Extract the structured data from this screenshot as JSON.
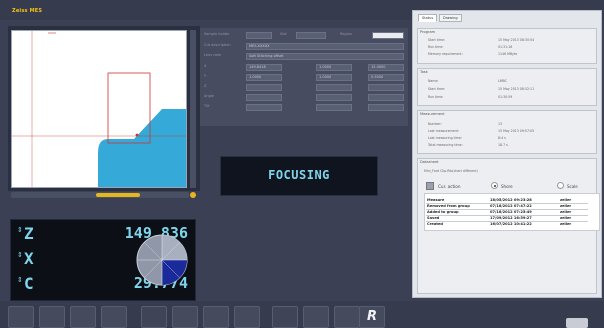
{
  "app": {
    "title": "Zeiss MES"
  },
  "form": {
    "rows": [
      {
        "label": "Sample holder",
        "value": "",
        "label2": "Slot",
        "value2": "",
        "label3": "Region",
        "value3": ""
      },
      {
        "label": "Cut description",
        "value": "MES-XXXXX"
      },
      {
        "label": "Lens note",
        "value": "Soft Stitching offset"
      },
      {
        "label": "X",
        "value": "149.8418",
        "value2": "1.0000",
        "value3": "15.0000"
      },
      {
        "label": "Y",
        "value": "1.0000",
        "value2": "1.0000",
        "value3": "0.5000"
      },
      {
        "label": "Z",
        "value": "",
        "value2": "",
        "value3": ""
      },
      {
        "label": "Angle",
        "value": "",
        "value2": "",
        "value3": ""
      },
      {
        "label": "Tilt",
        "value": "",
        "value2": "",
        "value3": ""
      }
    ]
  },
  "status": {
    "text": "FOCUSING"
  },
  "readout": {
    "axes": [
      {
        "name": "Z",
        "value": "149.836"
      },
      {
        "name": "X",
        "value": "3.828"
      },
      {
        "name": "C",
        "value": "29.774"
      }
    ],
    "arrow": "⇕"
  },
  "toolbar": {
    "r_label": "R"
  },
  "info": {
    "tabs": [
      "Status",
      "Drawing"
    ],
    "program": {
      "title": "Program",
      "rows": [
        {
          "k": "Start time:",
          "v": "15 May 2013 08:30:54"
        },
        {
          "k": "Run time:",
          "v": "01:31:16"
        },
        {
          "k": "Memory requirement:",
          "v": "1146 MByte"
        }
      ]
    },
    "task": {
      "title": "Task",
      "rows": [
        {
          "k": "Name:",
          "v": "LMBC"
        },
        {
          "k": "Start time:",
          "v": "15 May 2013 08:32:11"
        },
        {
          "k": "Run time:",
          "v": "01:30:59"
        }
      ]
    },
    "measurement": {
      "title": "Measurement",
      "rows": [
        {
          "k": "Number:",
          "v": "13"
        },
        {
          "k": "Last measurement:",
          "v": "15 May 2013 09:57:05"
        },
        {
          "k": "Last measuring time:",
          "v": "8:4 s"
        },
        {
          "k": "Total measuring time:",
          "v": "18.7 s"
        }
      ]
    },
    "datasheet": {
      "title": "Datasheet",
      "subtitle": "Mini_Ford Clip-Rib(chart different)",
      "current_action_label": "Cur. action",
      "radio1": "Shore",
      "radio2": "Scale",
      "history": [
        {
          "action": "Measure",
          "date": "18/05/2012 09:23:28",
          "user": "zeiler"
        },
        {
          "action": "Removed from group",
          "date": "07/16/2012 07:47:22",
          "user": "zeiler"
        },
        {
          "action": "Added to group",
          "date": "07/16/2012 07:25:49",
          "user": "zeiler"
        },
        {
          "action": "Saved",
          "date": "17/09/2012 16:59:27",
          "user": "zeiler"
        },
        {
          "action": "Created",
          "date": "16/07/2012 10:41:22",
          "user": "zeiler"
        }
      ]
    }
  },
  "colors": {
    "accent": "#7fd6ec",
    "highlight": "#e7b51d",
    "shape": "#35a9d8",
    "marker": "#cc3333",
    "dial_fill": "#1a2a9a"
  }
}
